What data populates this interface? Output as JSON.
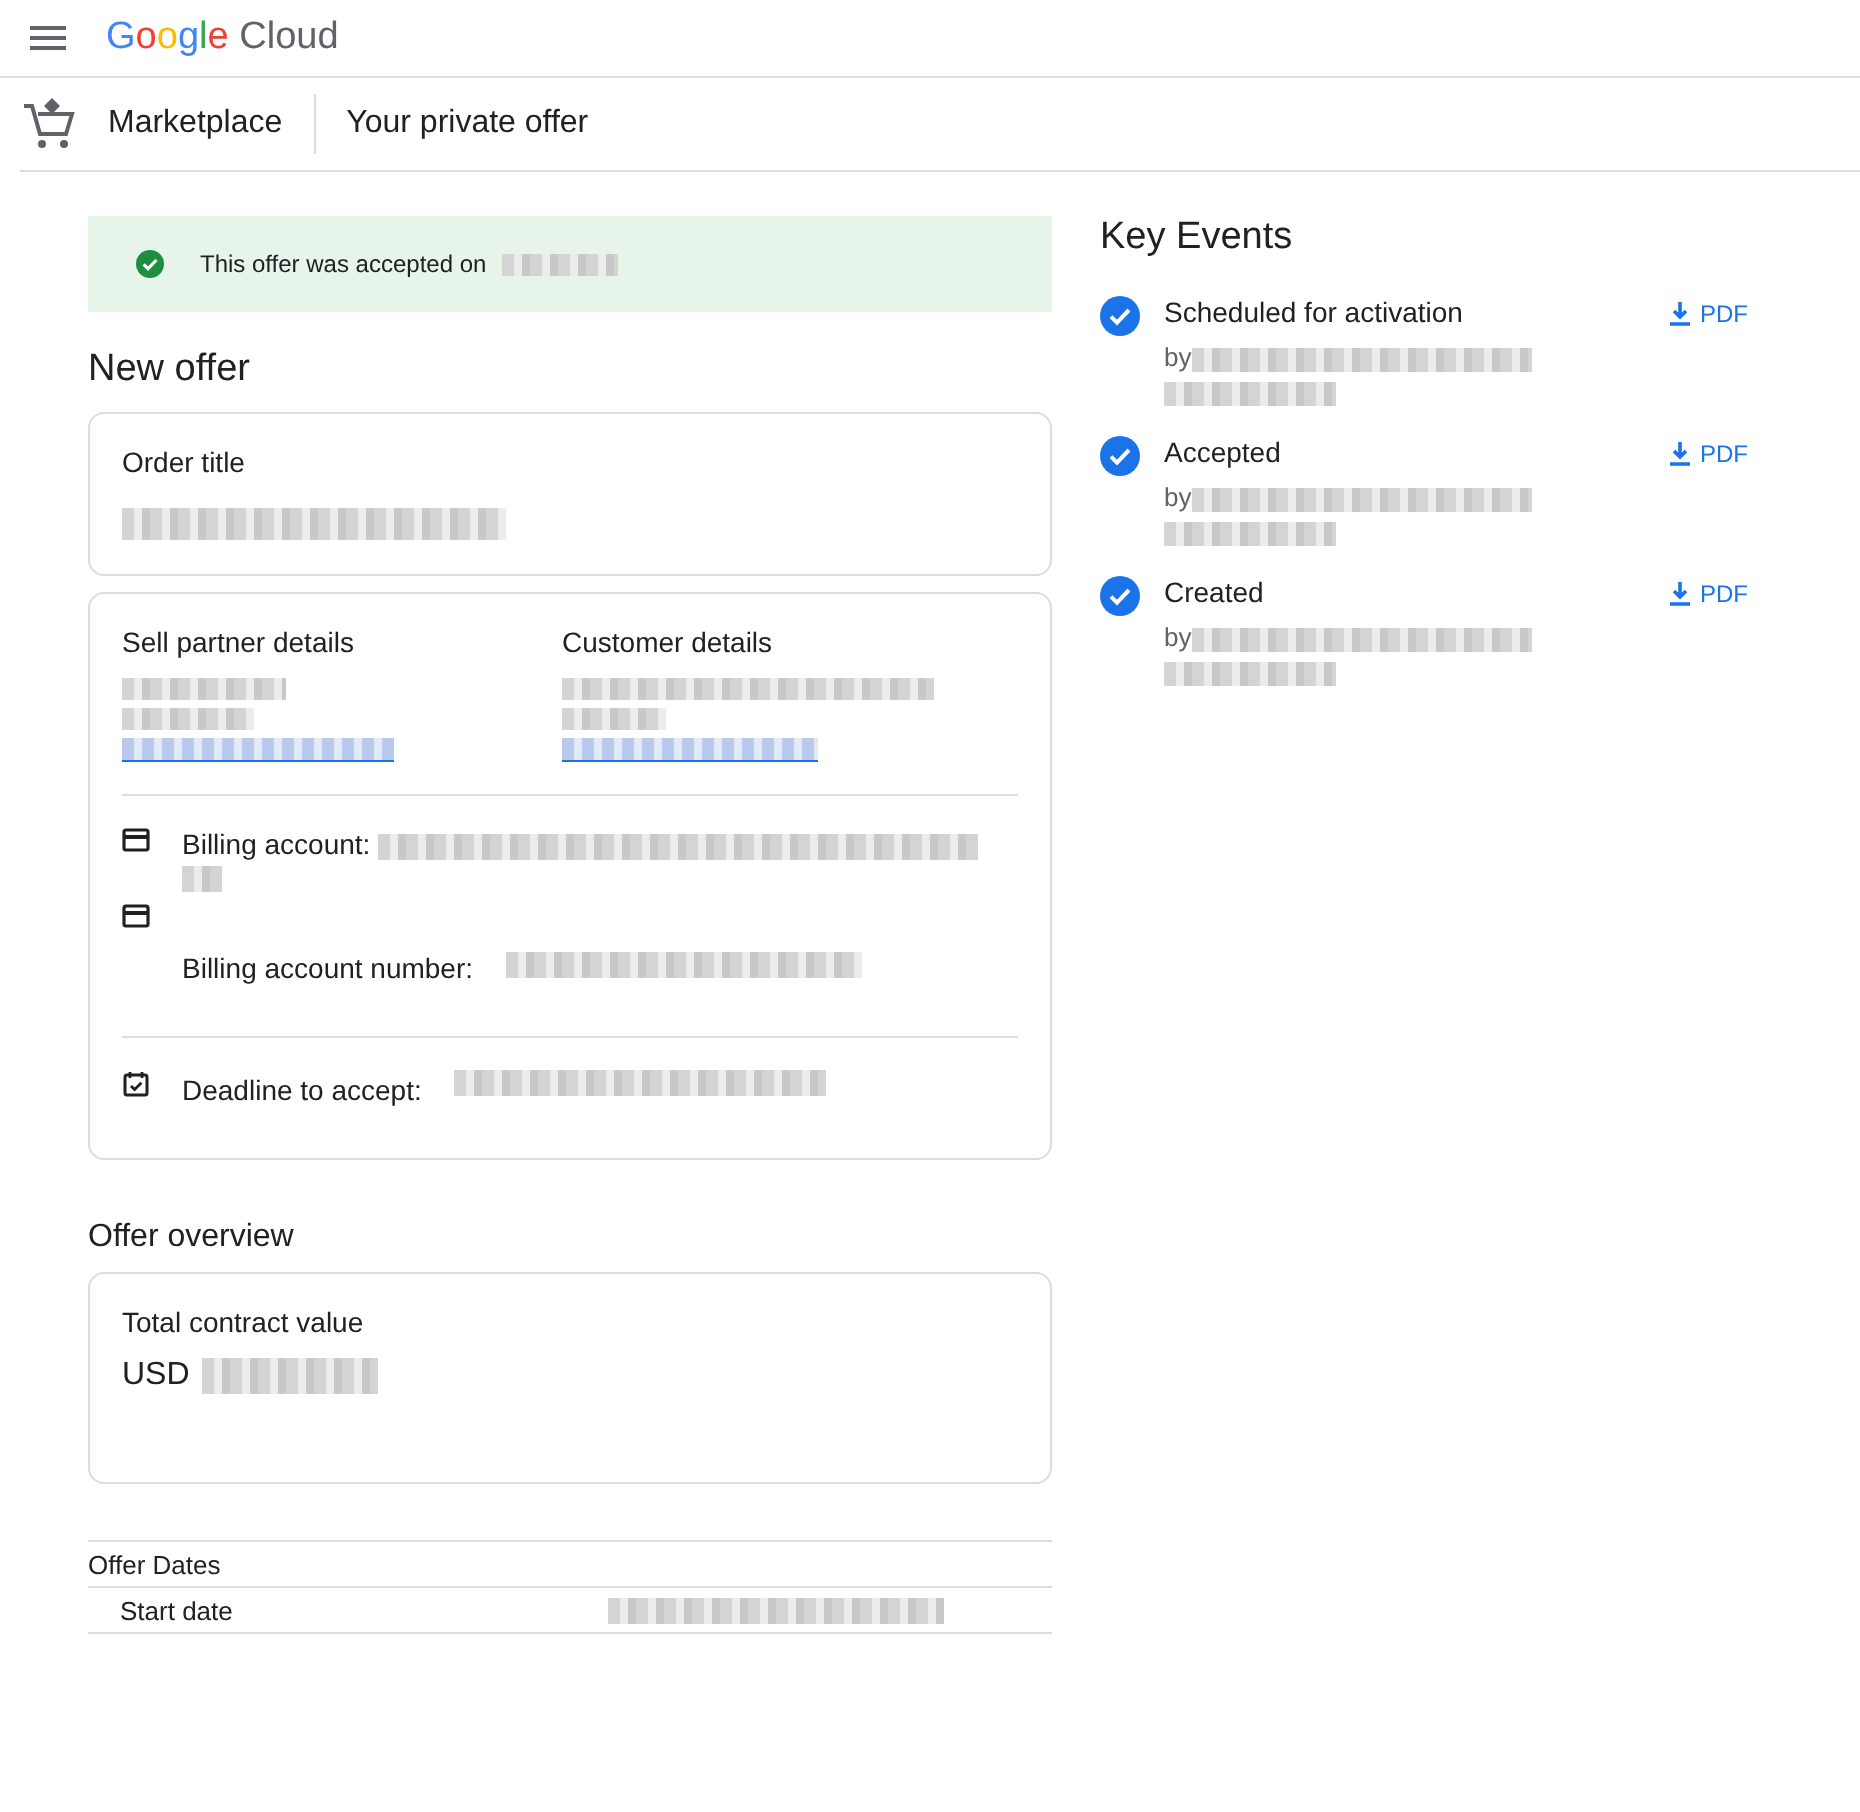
{
  "header": {
    "logo": "Google Cloud"
  },
  "breadcrumb": {
    "section": "Marketplace",
    "page": "Your private offer"
  },
  "banner": {
    "text": "This offer was accepted on"
  },
  "offer": {
    "heading": "New offer",
    "order_title_label": "Order title",
    "seller_label": "Sell partner details",
    "customer_label": "Customer details",
    "billing_account_label": "Billing account:",
    "billing_number_label": "Billing account number:",
    "deadline_label": "Deadline to accept:"
  },
  "overview": {
    "heading": "Offer overview",
    "total_label": "Total contract value",
    "currency": "USD"
  },
  "dates": {
    "heading": "Offer Dates",
    "rows": [
      {
        "label": "Start date"
      }
    ]
  },
  "key_events": {
    "heading": "Key Events",
    "items": [
      {
        "title": "Scheduled for activation",
        "by": "by",
        "download": "PDF",
        "done": true
      },
      {
        "title": "Accepted",
        "by": "by",
        "download": "PDF",
        "done": true
      },
      {
        "title": "Created",
        "by": "by",
        "download": "PDF",
        "done": true
      }
    ]
  }
}
